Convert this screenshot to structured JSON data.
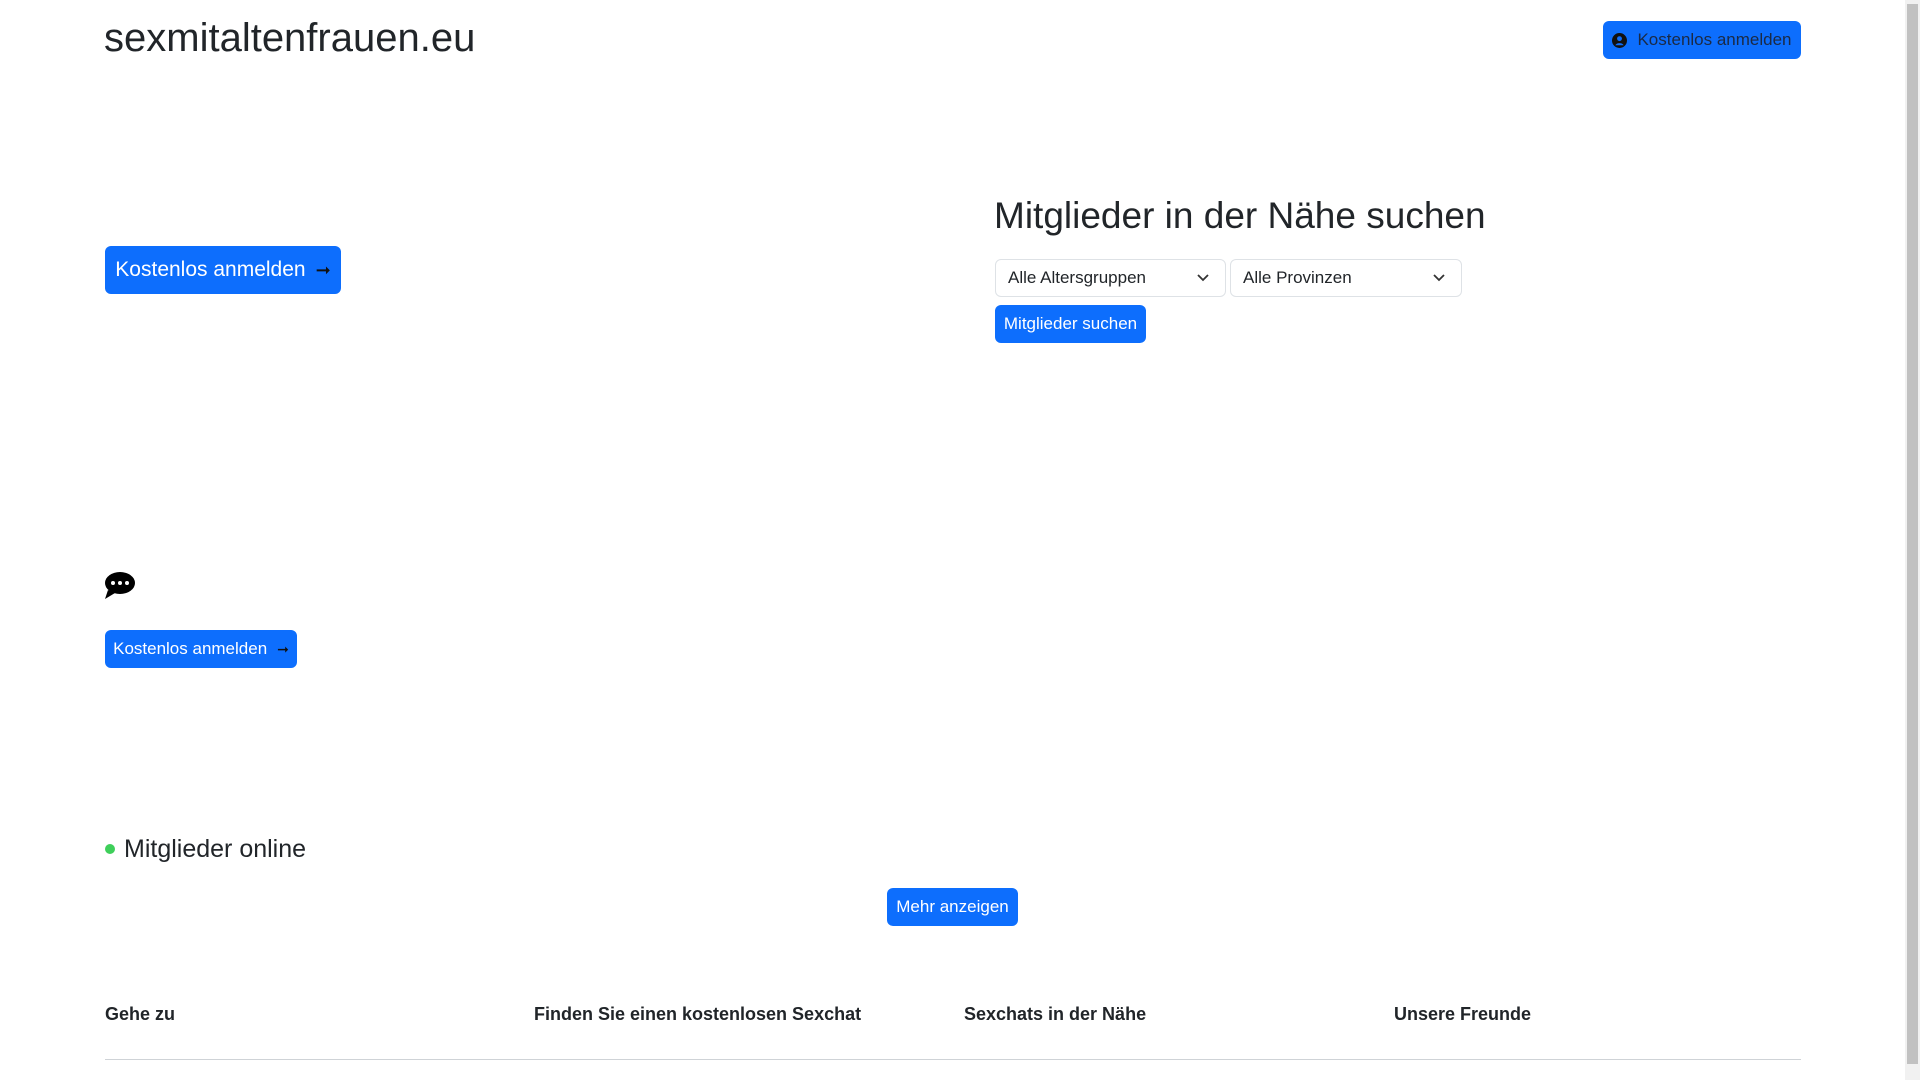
{
  "header": {
    "site_title": "sexmitaltenfrauen.eu",
    "signup_label": "Kostenlos anmelden"
  },
  "hero": {
    "signup_label": "Kostenlos anmelden"
  },
  "search": {
    "heading": "Mitglieder in der Nähe suchen",
    "age_select": "Alle Altersgruppen",
    "province_select": "Alle Provinzen",
    "search_label": "Mitglieder suchen"
  },
  "chat": {
    "signup_label": "Kostenlos anmelden"
  },
  "online": {
    "heading": "Mitglieder online",
    "more_label": "Mehr anzeigen",
    "dot_color": "#3ecf5a"
  },
  "footer": {
    "headings": [
      "Gehe zu",
      "Finden Sie einen kostenlosen Sexchat",
      "Sexchats in der Nähe",
      "Unsere Freunde"
    ]
  },
  "colors": {
    "primary": "#0d6efd"
  }
}
